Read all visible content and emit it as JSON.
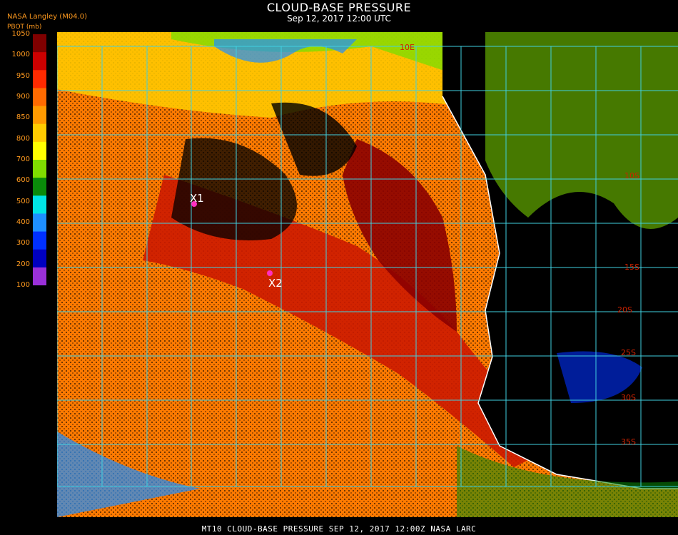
{
  "header": {
    "title": "CLOUD-BASE PRESSURE",
    "subtitle": "Sep 12, 2017 12:00 UTC",
    "provider": "NASA Langley (M04.0)"
  },
  "colorbar": {
    "title": "PBOT (mb)",
    "ticks": [
      "1050",
      "1000",
      "950",
      "900",
      "850",
      "800",
      "700",
      "600",
      "500",
      "400",
      "300",
      "200",
      "100"
    ],
    "colors": [
      "#7f0000",
      "#cc0000",
      "#ff2a00",
      "#ff6a00",
      "#ff9a00",
      "#ffcc00",
      "#ffff00",
      "#7fdc00",
      "#0a8a0a",
      "#00e5e5",
      "#1e8fff",
      "#0030ff",
      "#0000c0",
      "#9a30d8"
    ]
  },
  "map": {
    "grid_color": "#40d0e0",
    "latitude_labels": [
      "10S",
      "15S",
      "20S",
      "25S",
      "30S",
      "35S",
      "10E"
    ],
    "markers": [
      {
        "label": "X1",
        "color": "#ff30c0"
      },
      {
        "label": "X2",
        "color": "#ff30c0"
      }
    ]
  },
  "footer": {
    "text": "MT10  CLOUD-BASE PRESSURE  SEP 12, 2017 12:00Z  NASA LARC"
  }
}
